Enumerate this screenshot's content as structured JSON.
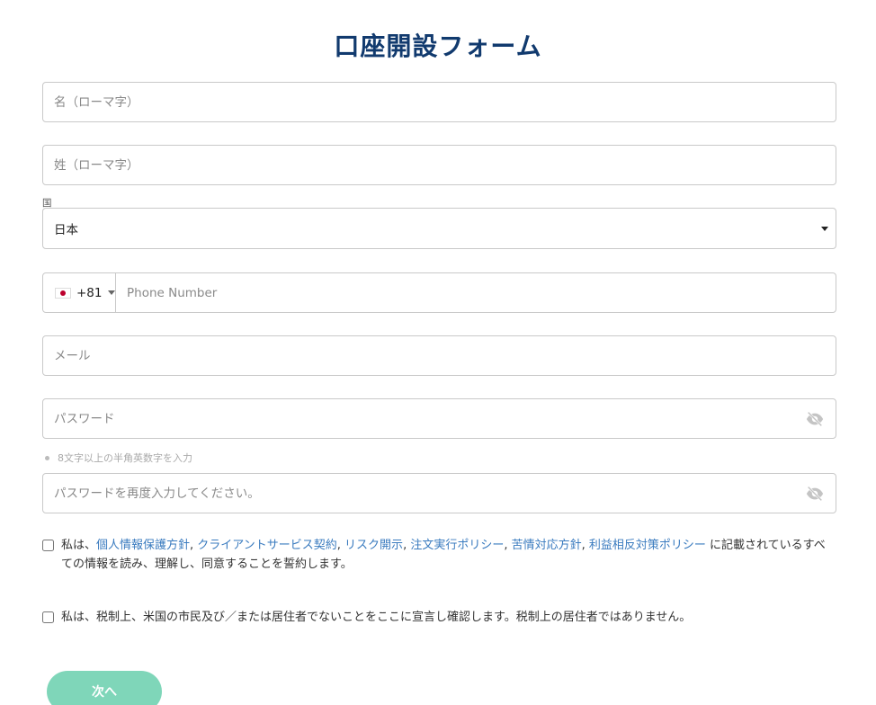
{
  "form": {
    "title": "口座開設フォーム",
    "first_name_placeholder": "名（ローマ字）",
    "last_name_placeholder": "姓（ローマ字）",
    "country_label": "国",
    "country_value": "日本",
    "phone_dial_code": "+81",
    "phone_placeholder": "Phone Number",
    "email_placeholder": "メール",
    "password_placeholder": "パスワード",
    "password_hint": "8文字以上の半角英数字を入力",
    "password_confirm_placeholder": "パスワードを再度入力してください。",
    "agreement": {
      "prefix": "私は、",
      "links": [
        "個人情報保護方針",
        "クライアントサービス契約",
        "リスク開示",
        "注文実行ポリシー",
        "苦情対応方針",
        "利益相反対策ポリシー"
      ],
      "separator": ", ",
      "suffix": " に記載されているすべての情報を読み、理解し、同意することを誓約します。"
    },
    "tax_declaration": "私は、税制上、米国の市民及び／または居住者でないことをここに宣言し確認します。税制上の居住者ではありません。",
    "next_label": "次へ"
  },
  "colors": {
    "title": "#113a6e",
    "link": "#3a7bbf",
    "button": "#7fd6b9"
  },
  "icons": {
    "flag": "japan-flag-icon",
    "password_toggle": "eye-slash-icon"
  }
}
